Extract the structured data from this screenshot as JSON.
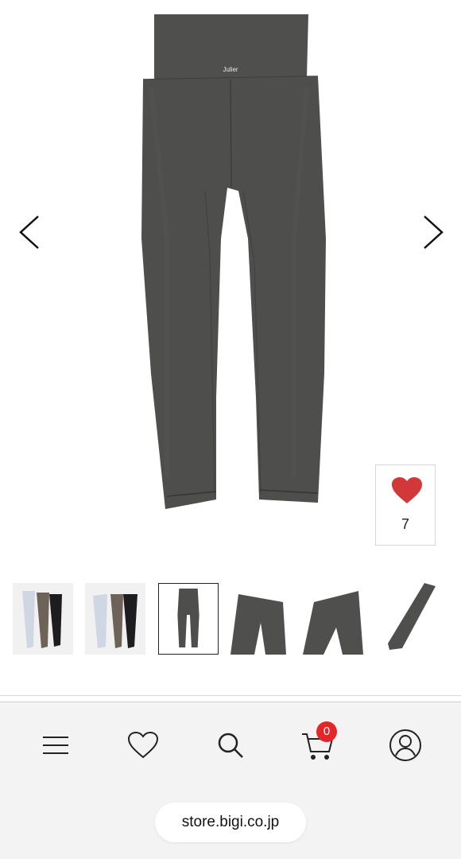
{
  "product": {
    "waistband_logo": "Julier",
    "favorite_count": "7"
  },
  "thumbnails": [
    {
      "name": "thumb-1",
      "variant": "three-colors-lineup"
    },
    {
      "name": "thumb-2",
      "variant": "three-colors-lineup"
    },
    {
      "name": "thumb-3",
      "variant": "charcoal-back",
      "active": true
    },
    {
      "name": "thumb-4",
      "variant": "waist-detail"
    },
    {
      "name": "thumb-5",
      "variant": "waist-detail-side"
    },
    {
      "name": "thumb-6",
      "variant": "leg-detail"
    }
  ],
  "bottom_nav": {
    "items": [
      {
        "icon": "menu-icon"
      },
      {
        "icon": "heart-icon"
      },
      {
        "icon": "search-icon"
      },
      {
        "icon": "cart-icon"
      },
      {
        "icon": "account-icon"
      }
    ],
    "cart_count": "0"
  },
  "browser": {
    "url": "store.bigi.co.jp"
  },
  "colors": {
    "product_gray": "#4e4e4d",
    "heart_red": "#d2373a",
    "badge_red": "#e3262a",
    "bar_bg": "#f3f3f3"
  }
}
